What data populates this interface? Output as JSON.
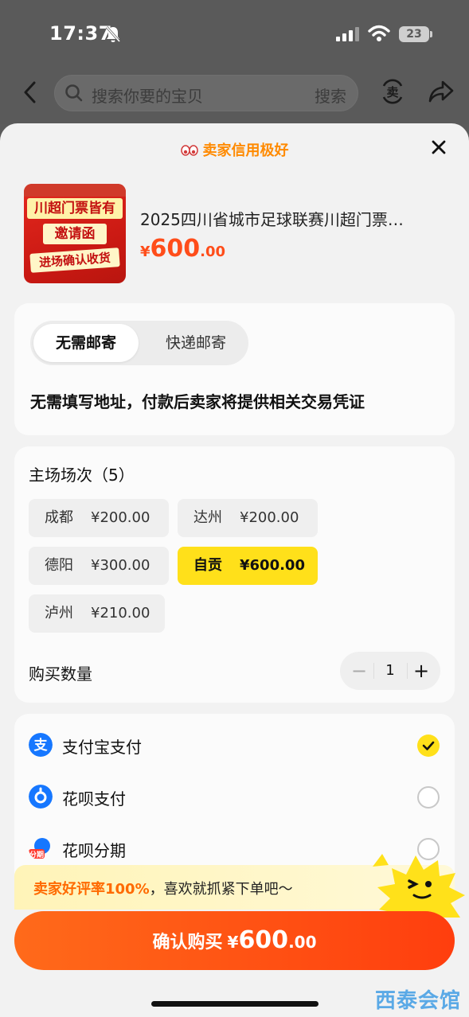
{
  "status_bar": {
    "time": "17:37",
    "battery": "23"
  },
  "nav": {
    "search_placeholder": "搜索你要的宝贝",
    "search_button": "搜索",
    "sell_icon_char": "卖"
  },
  "sheet": {
    "header": "卖家信用极好",
    "product": {
      "thumb_text": [
        "川超门票皆有",
        "邀请函",
        "进场确认收货"
      ],
      "title": "2025四川省城市足球联赛川超门票…",
      "price_symbol": "¥",
      "price_int": "600",
      "price_dec": ".00"
    },
    "shipping": {
      "options": [
        "无需邮寄",
        "快递邮寄"
      ],
      "selected": "无需邮寄",
      "note": "无需填写地址，付款后卖家将提供相关交易凭证"
    },
    "sessions": {
      "title": "主场场次（5）",
      "items": [
        {
          "city": "成都",
          "price": "¥200.00",
          "selected": false
        },
        {
          "city": "达州",
          "price": "¥200.00",
          "selected": false
        },
        {
          "city": "德阳",
          "price": "¥300.00",
          "selected": false
        },
        {
          "city": "自贡",
          "price": "¥600.00",
          "selected": true
        },
        {
          "city": "泸州",
          "price": "¥210.00",
          "selected": false
        }
      ]
    },
    "quantity": {
      "label": "购买数量",
      "value": "1",
      "minus": "−",
      "plus": "+"
    },
    "payment": {
      "methods": [
        {
          "label": "支付宝支付",
          "icon": "alipay-icon",
          "checked": true
        },
        {
          "label": "花呗支付",
          "icon": "huabei-icon",
          "checked": false
        },
        {
          "label": "花呗分期",
          "icon": "huabei-installment-icon",
          "checked": false
        }
      ]
    },
    "promo": {
      "highlight": "卖家好评率100%",
      "text": "，喜欢就抓紧下单吧～"
    },
    "buy_button": {
      "label": "确认购买",
      "symbol": "¥",
      "int": "600",
      "dec": ".00"
    }
  },
  "watermark": "西泰会馆",
  "colors": {
    "accent_yellow": "#ffe01a",
    "price_orange": "#ff4d1a",
    "button_orange": "#ff4a12",
    "alipay_blue": "#1677ff"
  }
}
